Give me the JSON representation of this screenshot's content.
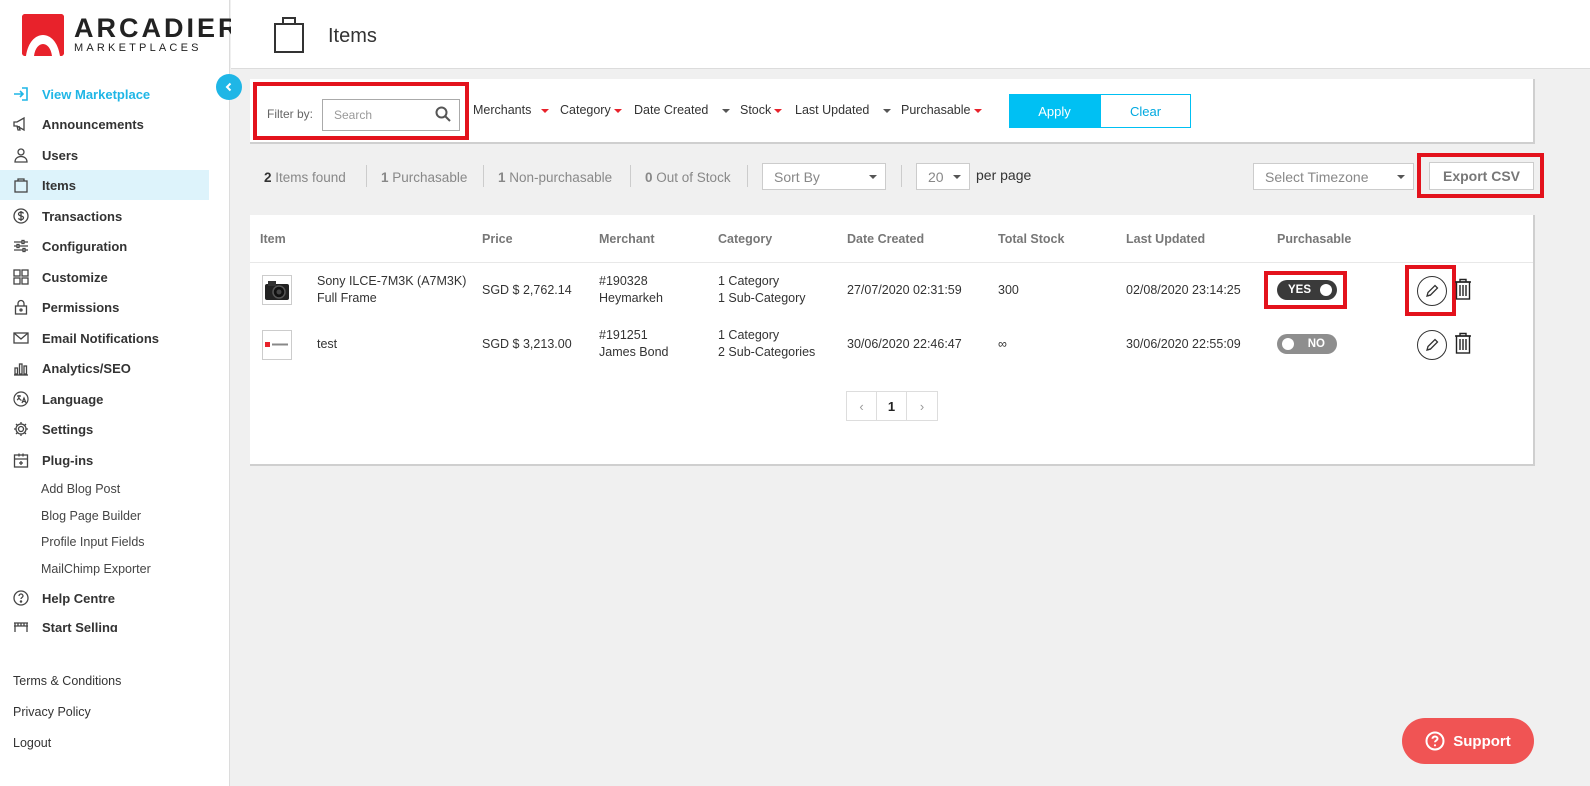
{
  "brand": {
    "name": "ARCADIER",
    "sub": "MARKETPLACES",
    "color": "#e8222b"
  },
  "accent_color": "#00c0f3",
  "sidebar": {
    "items": [
      {
        "label": "View Marketplace",
        "icon": "enter-icon"
      },
      {
        "label": "Announcements",
        "icon": "megaphone-icon"
      },
      {
        "label": "Users",
        "icon": "user-icon"
      },
      {
        "label": "Items",
        "icon": "shopping-bag-icon"
      },
      {
        "label": "Transactions",
        "icon": "dollar-icon"
      },
      {
        "label": "Configuration",
        "icon": "sliders-icon"
      },
      {
        "label": "Customize",
        "icon": "grid-icon"
      },
      {
        "label": "Permissions",
        "icon": "lock-icon"
      },
      {
        "label": "Email Notifications",
        "icon": "mail-icon"
      },
      {
        "label": "Analytics/SEO",
        "icon": "bar-chart-icon"
      },
      {
        "label": "Language",
        "icon": "translate-icon"
      },
      {
        "label": "Settings",
        "icon": "gear-icon"
      },
      {
        "label": "Plug-ins",
        "icon": "plugin-icon"
      }
    ],
    "plugins": [
      "Add Blog Post",
      "Blog Page Builder",
      "Profile Input Fields",
      "MailChimp Exporter"
    ],
    "more": [
      {
        "label": "Help Centre",
        "icon": "help-icon"
      },
      {
        "label": "Start Selling",
        "icon": "store-icon"
      }
    ],
    "footer": [
      "Terms & Conditions",
      "Privacy Policy",
      "Logout"
    ]
  },
  "header": {
    "title": "Items"
  },
  "filter": {
    "label": "Filter by:",
    "search_placeholder": "Search",
    "dropdowns": [
      "Merchants",
      "Category",
      "Date Created",
      "Stock",
      "Last Updated",
      "Purchasable"
    ],
    "apply": "Apply",
    "clear": "Clear"
  },
  "stats": {
    "items_found_count": "2",
    "items_found_label": "Items found",
    "purchasable_count": "1",
    "purchasable_label": "Purchasable",
    "non_purchasable_count": "1",
    "non_purchasable_label": "Non-purchasable",
    "out_of_stock_count": "0",
    "out_of_stock_label": "Out of Stock"
  },
  "sort_by": "Sort By",
  "per_page": {
    "value": "20",
    "label": "per page"
  },
  "timezone": "Select Timezone",
  "export": "Export CSV",
  "table": {
    "columns": [
      "Item",
      "Price",
      "Merchant",
      "Category",
      "Date Created",
      "Total Stock",
      "Last Updated",
      "Purchasable"
    ],
    "rows": [
      {
        "name_line1": "Sony ILCE-7M3K (A7M3K)",
        "name_line2": "Full Frame",
        "price": "SGD $ 2,762.14",
        "merchant_id": "#190328",
        "merchant_name": "Heymarkeh",
        "category_line1": "1 Category",
        "category_line2": "1 Sub-Category",
        "date_created": "27/07/2020 02:31:59",
        "stock": "300",
        "last_updated": "02/08/2020 23:14:25",
        "purchasable": "YES"
      },
      {
        "name_line1": "test",
        "name_line2": "",
        "price": "SGD $ 3,213.00",
        "merchant_id": "#191251",
        "merchant_name": "James Bond",
        "category_line1": "1 Category",
        "category_line2": "2 Sub-Categories",
        "date_created": "30/06/2020 22:46:47",
        "stock": "∞",
        "last_updated": "30/06/2020 22:55:09",
        "purchasable": "NO"
      }
    ]
  },
  "pagination": {
    "prev": "‹",
    "current": "1",
    "next": "›"
  },
  "support": "Support"
}
